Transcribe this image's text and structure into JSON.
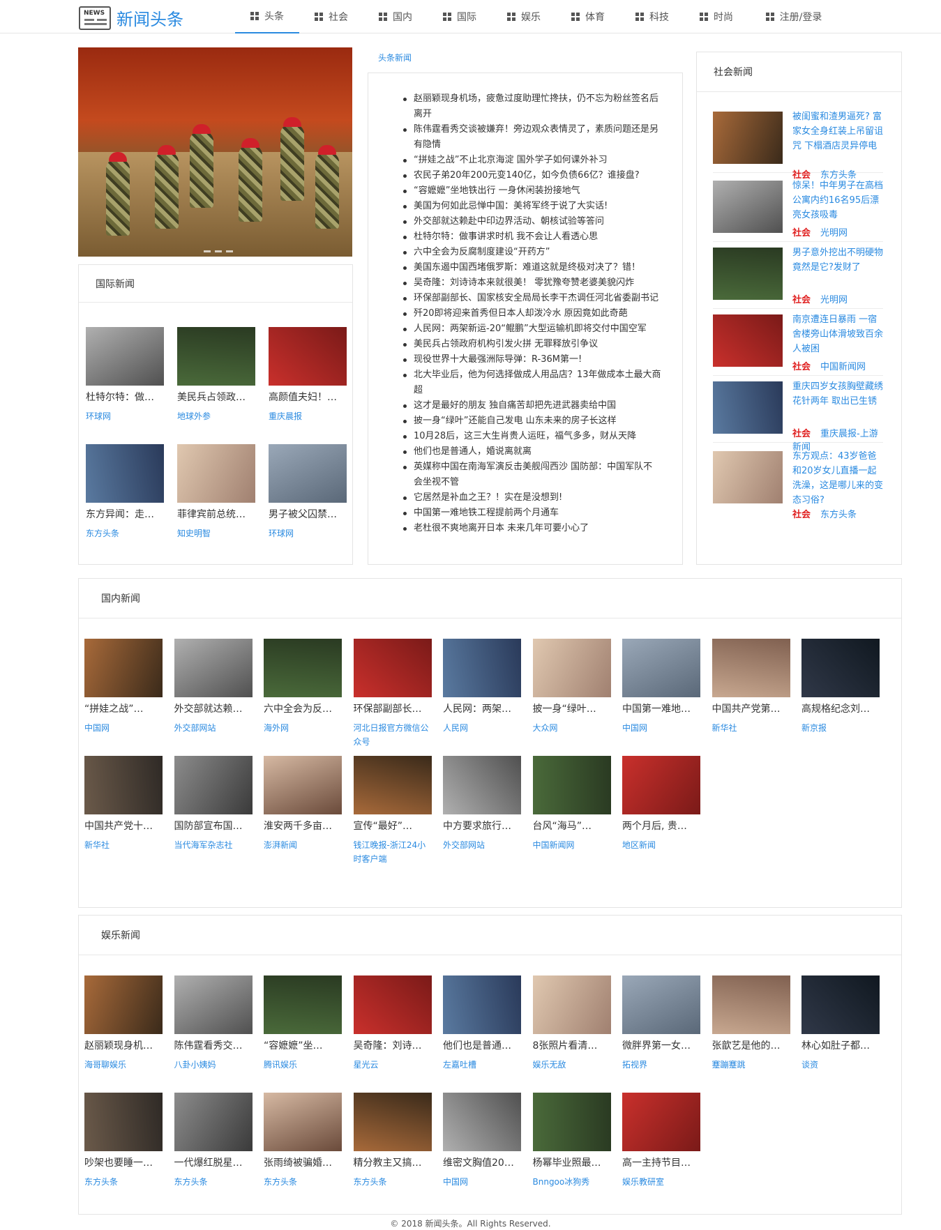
{
  "brand": {
    "logo_word": "NEWS",
    "name": "新闻头条"
  },
  "nav": [
    {
      "label": "头条",
      "icon": "grid-icon",
      "active": true
    },
    {
      "label": "社会",
      "icon": "grid-icon"
    },
    {
      "label": "国内",
      "icon": "grid-icon"
    },
    {
      "label": "国际",
      "icon": "grid-icon"
    },
    {
      "label": "娱乐",
      "icon": "grid-icon"
    },
    {
      "label": "体育",
      "icon": "grid-icon"
    },
    {
      "label": "科技",
      "icon": "grid-icon"
    },
    {
      "label": "时尚",
      "icon": "grid-icon"
    },
    {
      "label": "注册/登录",
      "icon": "grid-icon"
    }
  ],
  "headlines": {
    "title": "头条新闻",
    "items": [
      "赵丽颖现身机场，疲惫过度助理忙搀扶，仍不忘为粉丝签名后离开",
      "陈伟霆看秀交谈被嫌弃！旁边观众表情灵了，素质问题还是另有隐情",
      "“拼娃之战”不止北京海淀 国外学子如何课外补习",
      "农民子弟20年200元变140亿，如今负债66亿？谁接盘?",
      "“容嬷嬷”坐地铁出行 一身休闲装扮接地气",
      "美国为何如此忌惮中国：美将军终于说了大实话!",
      "外交部就达赖赴中印边界活动、朝核试验等答问",
      "杜特尔特：做事讲求时机 我不会让人看透心思",
      "六中全会为反腐制度建设“开药方”",
      "美国东遏中国西堵俄罗斯：难道这就是终极对决了？错！",
      "吴奇隆：刘诗诗本来就很美！ 零犹豫夸赞老婆美貌闪炸",
      "环保部副部长、国家核安全局局长李干杰调任河北省委副书记",
      "歼20即将迎来首秀但日本人却泼冷水 原因竟如此奇葩",
      "人民网：两架新运-20“鲲鹏”大型运输机即将交付中国空军",
      "美民兵占领政府机构引发火拼 无罪释放引争议",
      "现役世界十大最强洲际导弹：R-36M第一!",
      "北大毕业后，他为何选择做成人用品店？13年做成本土最大商超",
      "这才是最好的朋友 独自痛苦却把先进武器卖给中国",
      "披一身“绿叶”还能自己发电 山东未来的房子长这样",
      "10月28后，这三大生肖贵人运旺，福气多多，财从天降",
      "他们也是普通人，婚说离就离",
      "英媒称中国在南海军演反击美舰闯西沙 国防部：中国军队不会坐视不管",
      "它居然是补血之王？！实在是没想到!",
      "中国第一难地铁工程提前两个月通车",
      "老杜很不爽地离开日本 未来几年可要小心了"
    ]
  },
  "international": {
    "title": "国际新闻",
    "items": [
      {
        "title": "杜特尔特：做事讲求时机 我不会让人看透心思",
        "display": "杜特尔特：做…",
        "source": "环球网"
      },
      {
        "title": "美民兵占领政府机构",
        "display": "美民兵占领政…",
        "source": "地球外参"
      },
      {
        "title": "高颜值夫妇！",
        "display": "高颜值夫妇！…",
        "source": "重庆晨报"
      },
      {
        "title": "东方异闻：走…",
        "display": "东方异闻：走…",
        "source": "东方头条"
      },
      {
        "title": "菲律宾前总统…",
        "display": "菲律宾前总统…",
        "source": "知史明智"
      },
      {
        "title": "男子被父囚禁…",
        "display": "男子被父囚禁…",
        "source": "环球网"
      }
    ]
  },
  "society": {
    "title": "社会新闻",
    "items": [
      {
        "title": "被闺蜜和渣男逼死? 富家女全身红装上吊留诅咒 下榻酒店灵异停电",
        "tag": "社会",
        "source": "东方头条"
      },
      {
        "title": "惊呆！中年男子在高档公寓内约16名95后漂亮女孩吸毒",
        "tag": "社会",
        "source": "光明网"
      },
      {
        "title": "男子意外挖出不明硬物竟然是它?发财了",
        "tag": "社会",
        "source": "光明网"
      },
      {
        "title": "南京遭连日暴雨 一宿舍楼旁山体滑坡致百余人被困",
        "tag": "社会",
        "source": "中国新闻网"
      },
      {
        "title": "重庆四岁女孩胸壁藏绣花针两年 取出已生锈",
        "tag": "社会",
        "source": "重庆晨报-上游新闻"
      },
      {
        "title": "东方观点：43岁爸爸和20岁女儿直播一起洗澡，这是哪儿来的变态习俗?",
        "tag": "社会",
        "source": "东方头条"
      }
    ]
  },
  "domestic": {
    "title": "国内新闻",
    "items": [
      {
        "display": "“拼娃之战”…",
        "source": "中国网"
      },
      {
        "display": "外交部就达赖…",
        "source": "外交部网站"
      },
      {
        "display": "六中全会为反…",
        "source": "海外网"
      },
      {
        "display": "环保部副部长…",
        "source": "河北日报官方微信公众号"
      },
      {
        "display": "人民网：两架…",
        "source": "人民网"
      },
      {
        "display": "披一身“绿叶…",
        "source": "大众网"
      },
      {
        "display": "中国第一难地…",
        "source": "中国网"
      },
      {
        "display": "中国共产党第…",
        "source": "新华社"
      },
      {
        "display": "高规格纪念刘…",
        "source": "新京报"
      },
      {
        "display": "中国共产党十…",
        "source": "新华社"
      },
      {
        "display": "国防部宣布国…",
        "source": "当代海军杂志社"
      },
      {
        "display": "淮安两千多亩…",
        "source": "澎湃新闻"
      },
      {
        "display": "宣传“最好”…",
        "source": "钱江晚报-浙江24小时客户端"
      },
      {
        "display": "中方要求旅行…",
        "source": "外交部网站"
      },
      {
        "display": "台风“海马”…",
        "source": "中国新闻网"
      },
      {
        "display": "两个月后, 贵…",
        "source": "地区新闻"
      }
    ]
  },
  "entertainment": {
    "title": "娱乐新闻",
    "items": [
      {
        "display": "赵丽颖现身机…",
        "source": "海哥聊娱乐"
      },
      {
        "display": "陈伟霆看秀交…",
        "source": "八卦小姨妈"
      },
      {
        "display": "“容嬷嬷”坐…",
        "source": "腾讯娱乐"
      },
      {
        "display": "吴奇隆：刘诗…",
        "source": "星光云"
      },
      {
        "display": "他们也是普通…",
        "source": "左嘉吐槽"
      },
      {
        "display": "8张照片看清…",
        "source": "娱乐无敌"
      },
      {
        "display": "微胖界第一女…",
        "source": "拓视界"
      },
      {
        "display": "张歆艺是他的…",
        "source": "蹇蹦蹇跳"
      },
      {
        "display": "林心如肚子都…",
        "source": "谈资"
      },
      {
        "display": "吵架也要睡一…",
        "source": "东方头条"
      },
      {
        "display": "一代爆红脱星…",
        "source": "东方头条"
      },
      {
        "display": "张雨绮被骗婚…",
        "source": "东方头条"
      },
      {
        "display": "精分教主又搞…",
        "source": "东方头条"
      },
      {
        "display": "维密文胸值20…",
        "source": "中国网"
      },
      {
        "display": "杨幂毕业照最…",
        "source": "Bnngoo冰狗秀"
      },
      {
        "display": "高一主持节目…",
        "source": "娱乐教研室"
      }
    ]
  },
  "footer": "© 2018 新闻头条。All Rights Reserved."
}
